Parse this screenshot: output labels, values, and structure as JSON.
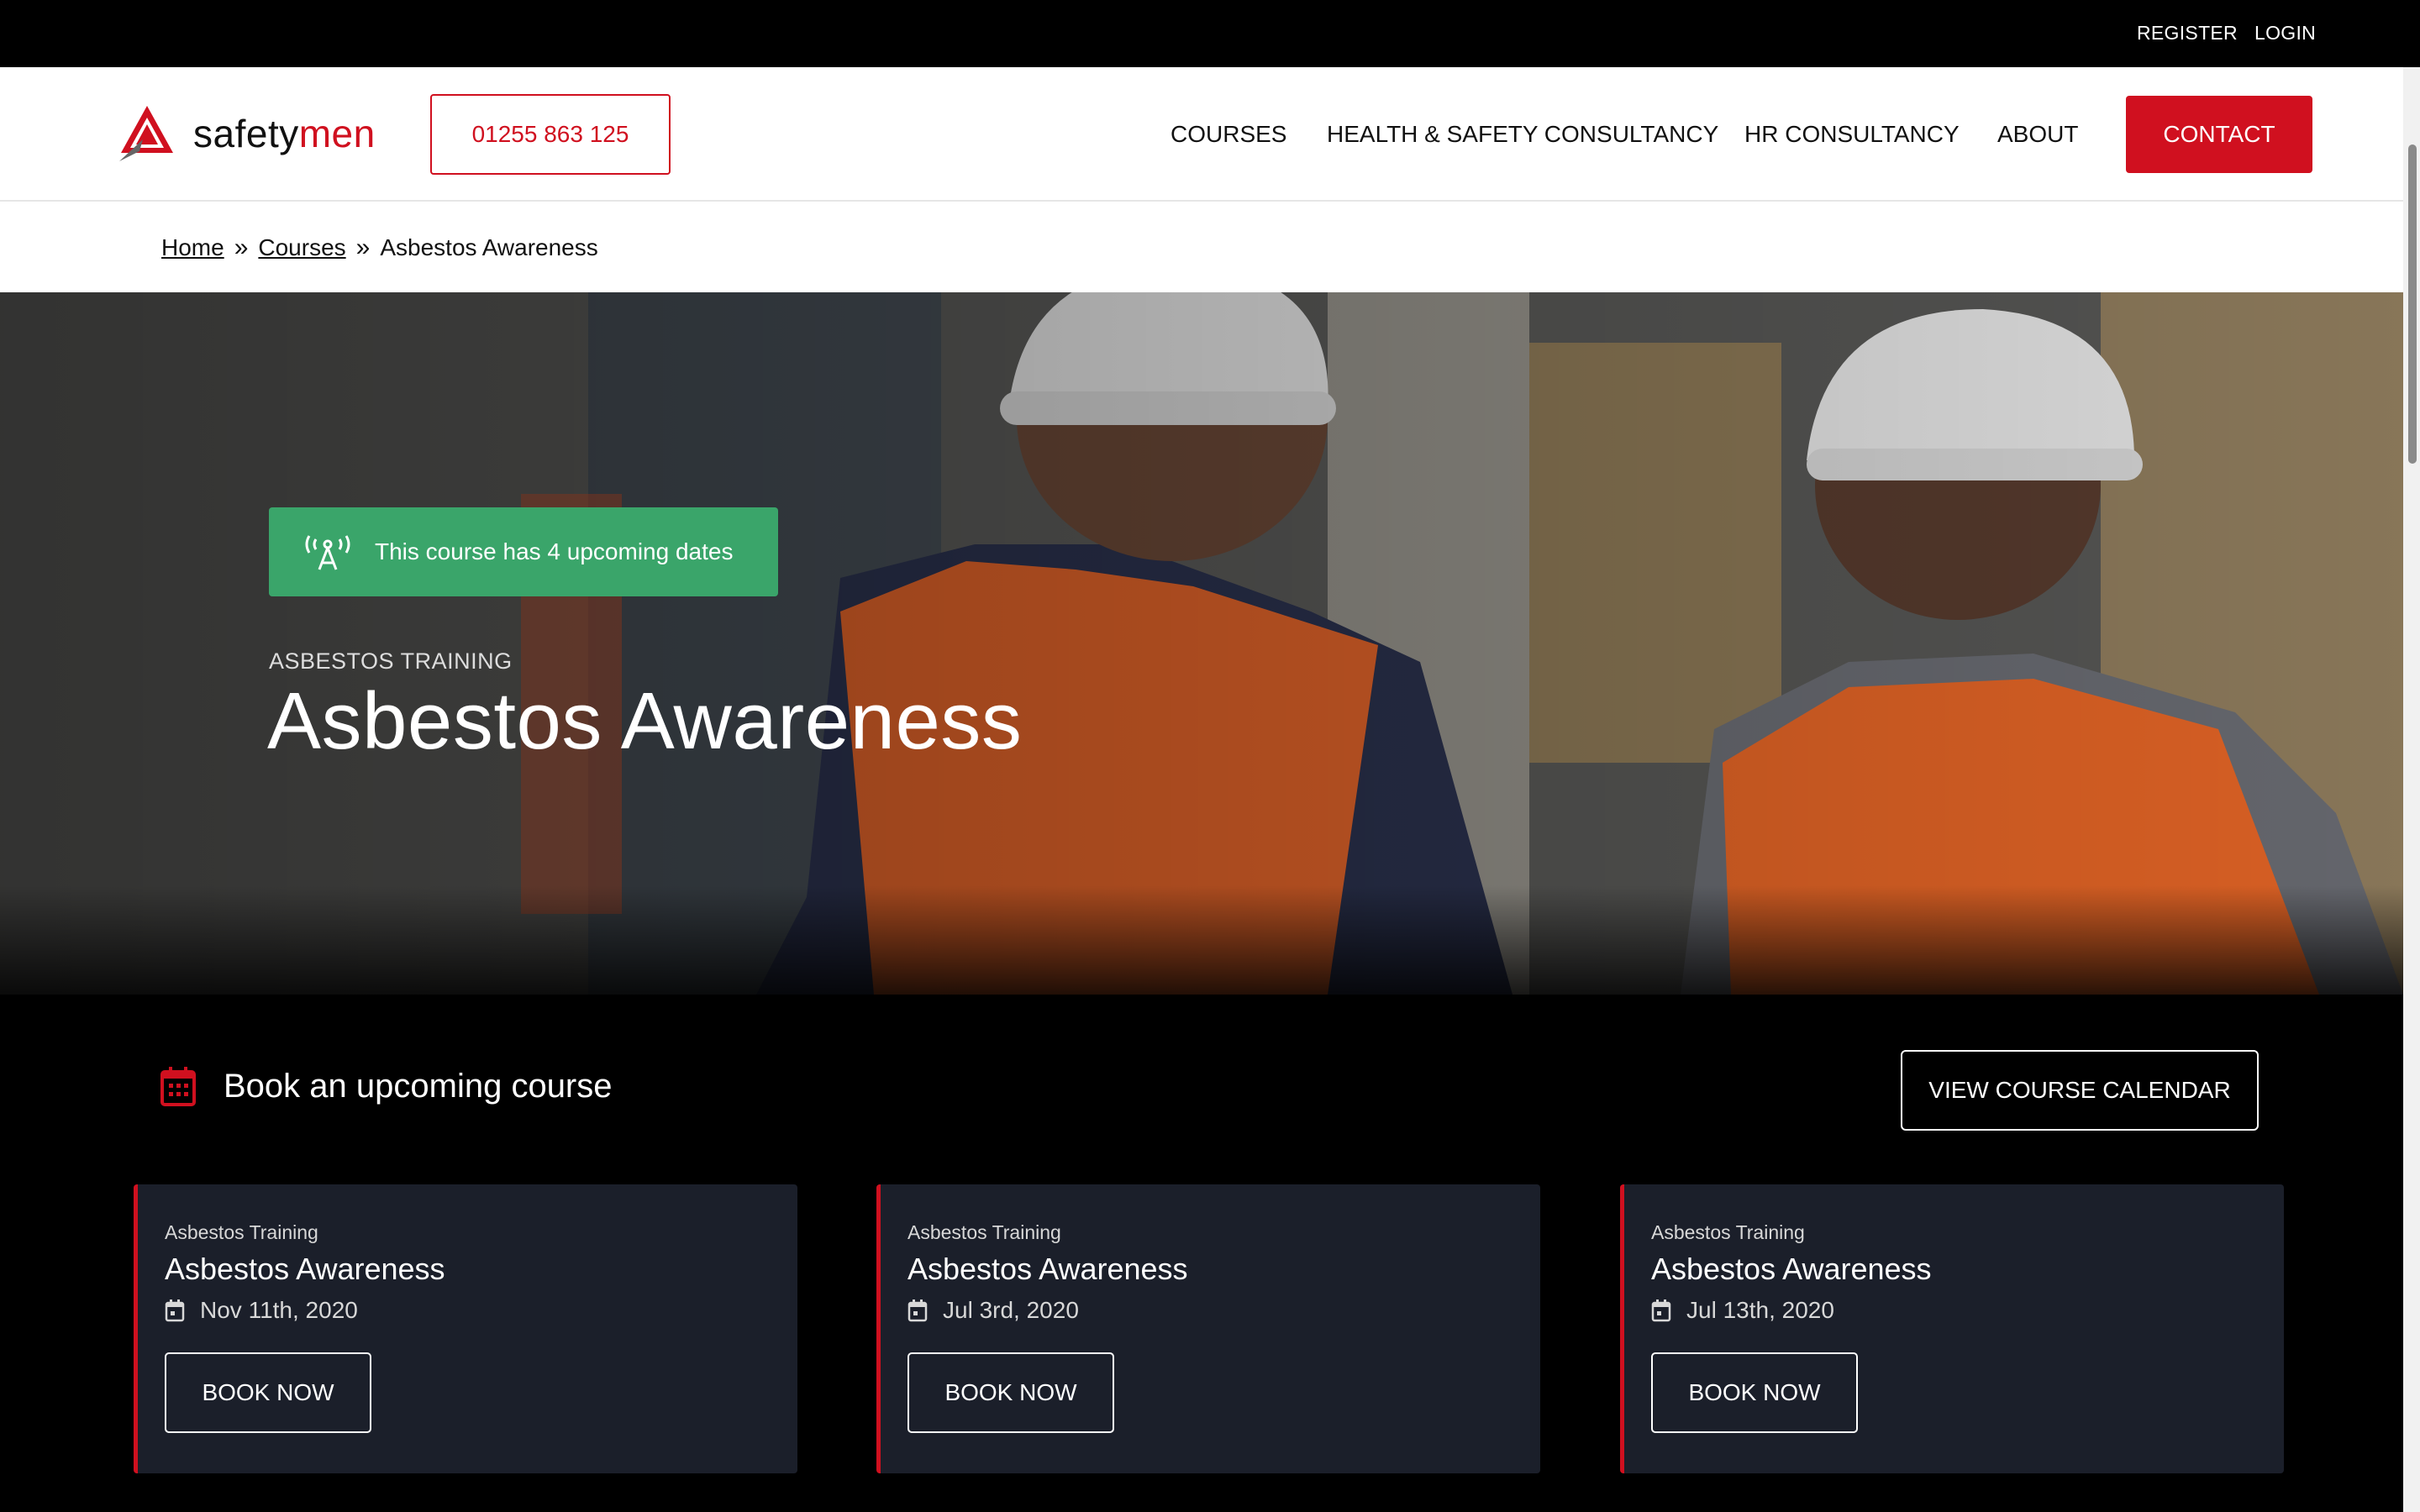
{
  "topbar": {
    "register": "REGISTER",
    "login": "LOGIN"
  },
  "header": {
    "logo": {
      "part1": "safety",
      "part2": "men"
    },
    "phone": "01255 863 125",
    "nav": [
      "COURSES",
      "HEALTH & SAFETY CONSULTANCY",
      "HR CONSULTANCY",
      "ABOUT"
    ],
    "contact": "CONTACT"
  },
  "breadcrumb": {
    "home": "Home",
    "courses": "Courses",
    "current": "Asbestos Awareness"
  },
  "hero": {
    "badge": "This course has 4 upcoming dates",
    "category": "ASBESTOS TRAINING",
    "title": "Asbestos Awareness"
  },
  "booking": {
    "heading": "Book an upcoming course",
    "calendar_button": "VIEW COURSE CALENDAR",
    "cards": [
      {
        "category": "Asbestos Training",
        "name": "Asbestos Awareness",
        "date": "Nov 11th, 2020",
        "button": "BOOK NOW"
      },
      {
        "category": "Asbestos Training",
        "name": "Asbestos Awareness",
        "date": "Jul 3rd, 2020",
        "button": "BOOK NOW"
      },
      {
        "category": "Asbestos Training",
        "name": "Asbestos Awareness",
        "date": "Jul 13th, 2020",
        "button": "BOOK NOW"
      }
    ]
  },
  "colors": {
    "brand_red": "#d0101f",
    "badge_green": "#3aa56a",
    "card_bg": "#1b1f2a"
  }
}
